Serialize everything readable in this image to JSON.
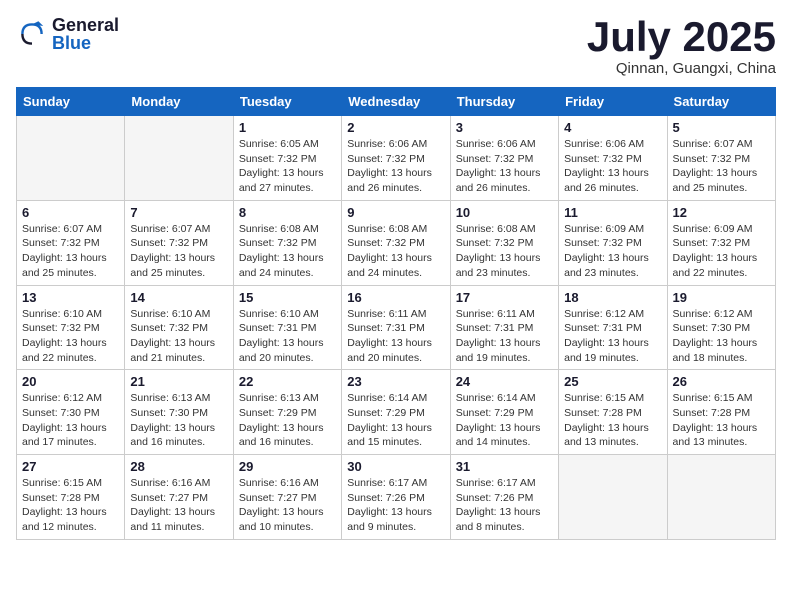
{
  "header": {
    "logo_general": "General",
    "logo_blue": "Blue",
    "month_year": "July 2025",
    "location": "Qinnan, Guangxi, China"
  },
  "weekdays": [
    "Sunday",
    "Monday",
    "Tuesday",
    "Wednesday",
    "Thursday",
    "Friday",
    "Saturday"
  ],
  "weeks": [
    [
      {
        "day": "",
        "info": ""
      },
      {
        "day": "",
        "info": ""
      },
      {
        "day": "1",
        "info": "Sunrise: 6:05 AM\nSunset: 7:32 PM\nDaylight: 13 hours and 27 minutes."
      },
      {
        "day": "2",
        "info": "Sunrise: 6:06 AM\nSunset: 7:32 PM\nDaylight: 13 hours and 26 minutes."
      },
      {
        "day": "3",
        "info": "Sunrise: 6:06 AM\nSunset: 7:32 PM\nDaylight: 13 hours and 26 minutes."
      },
      {
        "day": "4",
        "info": "Sunrise: 6:06 AM\nSunset: 7:32 PM\nDaylight: 13 hours and 26 minutes."
      },
      {
        "day": "5",
        "info": "Sunrise: 6:07 AM\nSunset: 7:32 PM\nDaylight: 13 hours and 25 minutes."
      }
    ],
    [
      {
        "day": "6",
        "info": "Sunrise: 6:07 AM\nSunset: 7:32 PM\nDaylight: 13 hours and 25 minutes."
      },
      {
        "day": "7",
        "info": "Sunrise: 6:07 AM\nSunset: 7:32 PM\nDaylight: 13 hours and 25 minutes."
      },
      {
        "day": "8",
        "info": "Sunrise: 6:08 AM\nSunset: 7:32 PM\nDaylight: 13 hours and 24 minutes."
      },
      {
        "day": "9",
        "info": "Sunrise: 6:08 AM\nSunset: 7:32 PM\nDaylight: 13 hours and 24 minutes."
      },
      {
        "day": "10",
        "info": "Sunrise: 6:08 AM\nSunset: 7:32 PM\nDaylight: 13 hours and 23 minutes."
      },
      {
        "day": "11",
        "info": "Sunrise: 6:09 AM\nSunset: 7:32 PM\nDaylight: 13 hours and 23 minutes."
      },
      {
        "day": "12",
        "info": "Sunrise: 6:09 AM\nSunset: 7:32 PM\nDaylight: 13 hours and 22 minutes."
      }
    ],
    [
      {
        "day": "13",
        "info": "Sunrise: 6:10 AM\nSunset: 7:32 PM\nDaylight: 13 hours and 22 minutes."
      },
      {
        "day": "14",
        "info": "Sunrise: 6:10 AM\nSunset: 7:32 PM\nDaylight: 13 hours and 21 minutes."
      },
      {
        "day": "15",
        "info": "Sunrise: 6:10 AM\nSunset: 7:31 PM\nDaylight: 13 hours and 20 minutes."
      },
      {
        "day": "16",
        "info": "Sunrise: 6:11 AM\nSunset: 7:31 PM\nDaylight: 13 hours and 20 minutes."
      },
      {
        "day": "17",
        "info": "Sunrise: 6:11 AM\nSunset: 7:31 PM\nDaylight: 13 hours and 19 minutes."
      },
      {
        "day": "18",
        "info": "Sunrise: 6:12 AM\nSunset: 7:31 PM\nDaylight: 13 hours and 19 minutes."
      },
      {
        "day": "19",
        "info": "Sunrise: 6:12 AM\nSunset: 7:30 PM\nDaylight: 13 hours and 18 minutes."
      }
    ],
    [
      {
        "day": "20",
        "info": "Sunrise: 6:12 AM\nSunset: 7:30 PM\nDaylight: 13 hours and 17 minutes."
      },
      {
        "day": "21",
        "info": "Sunrise: 6:13 AM\nSunset: 7:30 PM\nDaylight: 13 hours and 16 minutes."
      },
      {
        "day": "22",
        "info": "Sunrise: 6:13 AM\nSunset: 7:29 PM\nDaylight: 13 hours and 16 minutes."
      },
      {
        "day": "23",
        "info": "Sunrise: 6:14 AM\nSunset: 7:29 PM\nDaylight: 13 hours and 15 minutes."
      },
      {
        "day": "24",
        "info": "Sunrise: 6:14 AM\nSunset: 7:29 PM\nDaylight: 13 hours and 14 minutes."
      },
      {
        "day": "25",
        "info": "Sunrise: 6:15 AM\nSunset: 7:28 PM\nDaylight: 13 hours and 13 minutes."
      },
      {
        "day": "26",
        "info": "Sunrise: 6:15 AM\nSunset: 7:28 PM\nDaylight: 13 hours and 13 minutes."
      }
    ],
    [
      {
        "day": "27",
        "info": "Sunrise: 6:15 AM\nSunset: 7:28 PM\nDaylight: 13 hours and 12 minutes."
      },
      {
        "day": "28",
        "info": "Sunrise: 6:16 AM\nSunset: 7:27 PM\nDaylight: 13 hours and 11 minutes."
      },
      {
        "day": "29",
        "info": "Sunrise: 6:16 AM\nSunset: 7:27 PM\nDaylight: 13 hours and 10 minutes."
      },
      {
        "day": "30",
        "info": "Sunrise: 6:17 AM\nSunset: 7:26 PM\nDaylight: 13 hours and 9 minutes."
      },
      {
        "day": "31",
        "info": "Sunrise: 6:17 AM\nSunset: 7:26 PM\nDaylight: 13 hours and 8 minutes."
      },
      {
        "day": "",
        "info": ""
      },
      {
        "day": "",
        "info": ""
      }
    ]
  ]
}
